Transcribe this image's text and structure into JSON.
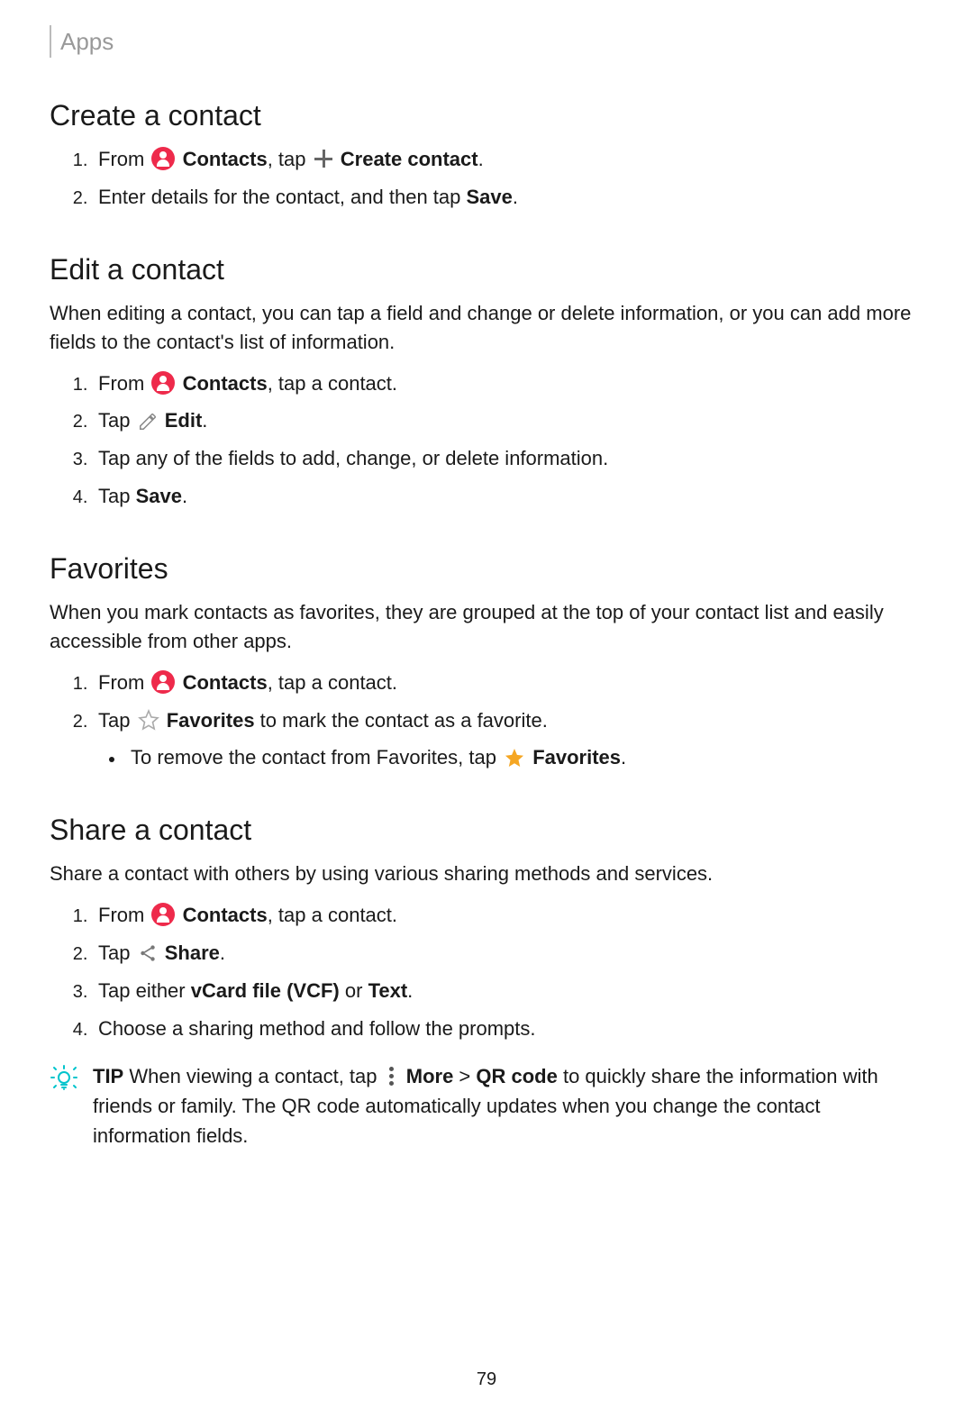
{
  "header": "Apps",
  "sections": {
    "create": {
      "title": "Create a contact",
      "step1_from": "From",
      "step1_contacts": " Contacts",
      "step1_tap": ", tap",
      "step1_create": " Create contact",
      "step1_period": ".",
      "step2_a": "Enter details for the contact, and then tap ",
      "step2_b": "Save",
      "step2_c": "."
    },
    "edit": {
      "title": "Edit a contact",
      "desc": "When editing a contact, you can tap a field and change or delete information, or you can add more fields to the contact's list of information.",
      "step1_from": "From",
      "step1_contacts": " Contacts",
      "step1_rest": ", tap a contact.",
      "step2_tap": "Tap",
      "step2_edit": " Edit",
      "step2_period": ".",
      "step3": "Tap any of the fields to add, change, or delete information.",
      "step4_a": "Tap ",
      "step4_b": "Save",
      "step4_c": "."
    },
    "fav": {
      "title": "Favorites",
      "desc": "When you mark contacts as favorites, they are grouped at the top of your contact list and easily accessible from other apps.",
      "step1_from": "From",
      "step1_contacts": " Contacts",
      "step1_rest": ", tap a contact.",
      "step2_tap": "Tap",
      "step2_fav": " Favorites",
      "step2_rest": " to mark the contact as a favorite.",
      "sub_a": "To remove the contact from Favorites, tap",
      "sub_b": " Favorites",
      "sub_c": "."
    },
    "share": {
      "title": "Share a contact",
      "desc": "Share a contact with others by using various sharing methods and services.",
      "step1_from": "From",
      "step1_contacts": " Contacts",
      "step1_rest": ", tap a contact.",
      "step2_tap": "Tap",
      "step2_share": " Share",
      "step2_period": ".",
      "step3_a": "Tap either ",
      "step3_b": "vCard file (VCF)",
      "step3_c": " or ",
      "step3_d": "Text",
      "step3_e": ".",
      "step4": "Choose a sharing method and follow the prompts."
    },
    "tip": {
      "label": "TIP",
      "a": "  When viewing a contact, tap",
      "more": " More",
      "gt": " > ",
      "qr": "QR code",
      "rest": " to quickly share the information with friends or family. The QR code automatically updates when you change the contact information fields."
    }
  },
  "page": "79"
}
